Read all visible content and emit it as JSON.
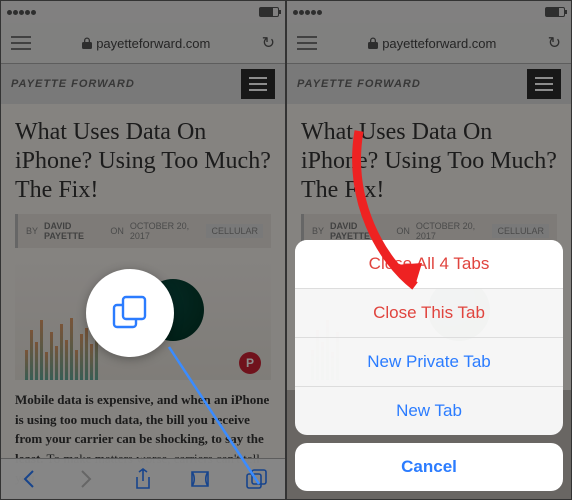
{
  "status": {
    "carrier": "",
    "time": ""
  },
  "nav": {
    "domain": "payetteforward.com"
  },
  "site": {
    "brand": "PAYETTE FORWARD"
  },
  "article": {
    "title": "What Uses Data On iPhone? Using Too Much? The Fix!",
    "by_prefix": "BY",
    "author": "DAVID PAYETTE",
    "on": "ON",
    "date": "OCTOBER 20, 2017",
    "category": "CELLULAR",
    "body_bold": "Mobile data is expensive, and when an iPhone is using too much data, the bill you receive from your carrier can be shocking, to say the least.",
    "body_rest": " To make matters worse, carriers can't tell you"
  },
  "sheet": {
    "close_all": "Close All 4 Tabs",
    "close_this": "Close This Tab",
    "new_private": "New Private Tab",
    "new_tab": "New Tab",
    "cancel": "Cancel"
  }
}
